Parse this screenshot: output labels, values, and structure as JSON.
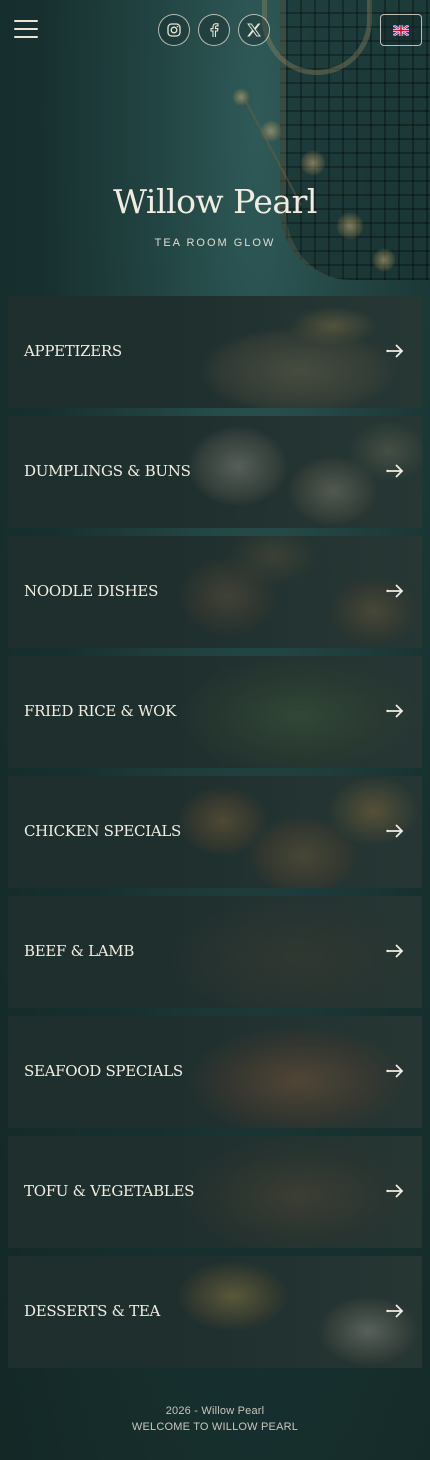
{
  "header": {
    "menu_icon": "hamburger-menu-icon",
    "socials": [
      {
        "name": "instagram-icon"
      },
      {
        "name": "facebook-icon"
      },
      {
        "name": "x-icon"
      }
    ],
    "language_flag": "uk-flag-icon"
  },
  "hero": {
    "title": "Willow Pearl",
    "subtitle": "TEA ROOM GLOW"
  },
  "categories": [
    {
      "label": "APPETIZERS"
    },
    {
      "label": "DUMPLINGS & BUNS"
    },
    {
      "label": "NOODLE DISHES"
    },
    {
      "label": "FRIED RICE & WOK"
    },
    {
      "label": "CHICKEN SPECIALS"
    },
    {
      "label": "BEEF & LAMB"
    },
    {
      "label": "SEAFOOD SPECIALS"
    },
    {
      "label": "TOFU & VEGETABLES"
    },
    {
      "label": "DESSERTS & TEA"
    }
  ],
  "footer": {
    "copyright": "2026 - Willow Pearl",
    "welcome": "WELCOME TO WILLOW PEARL"
  },
  "colors": {
    "background": "#1c3a39",
    "card": "#1f2f2e",
    "text": "#f2ede2"
  }
}
